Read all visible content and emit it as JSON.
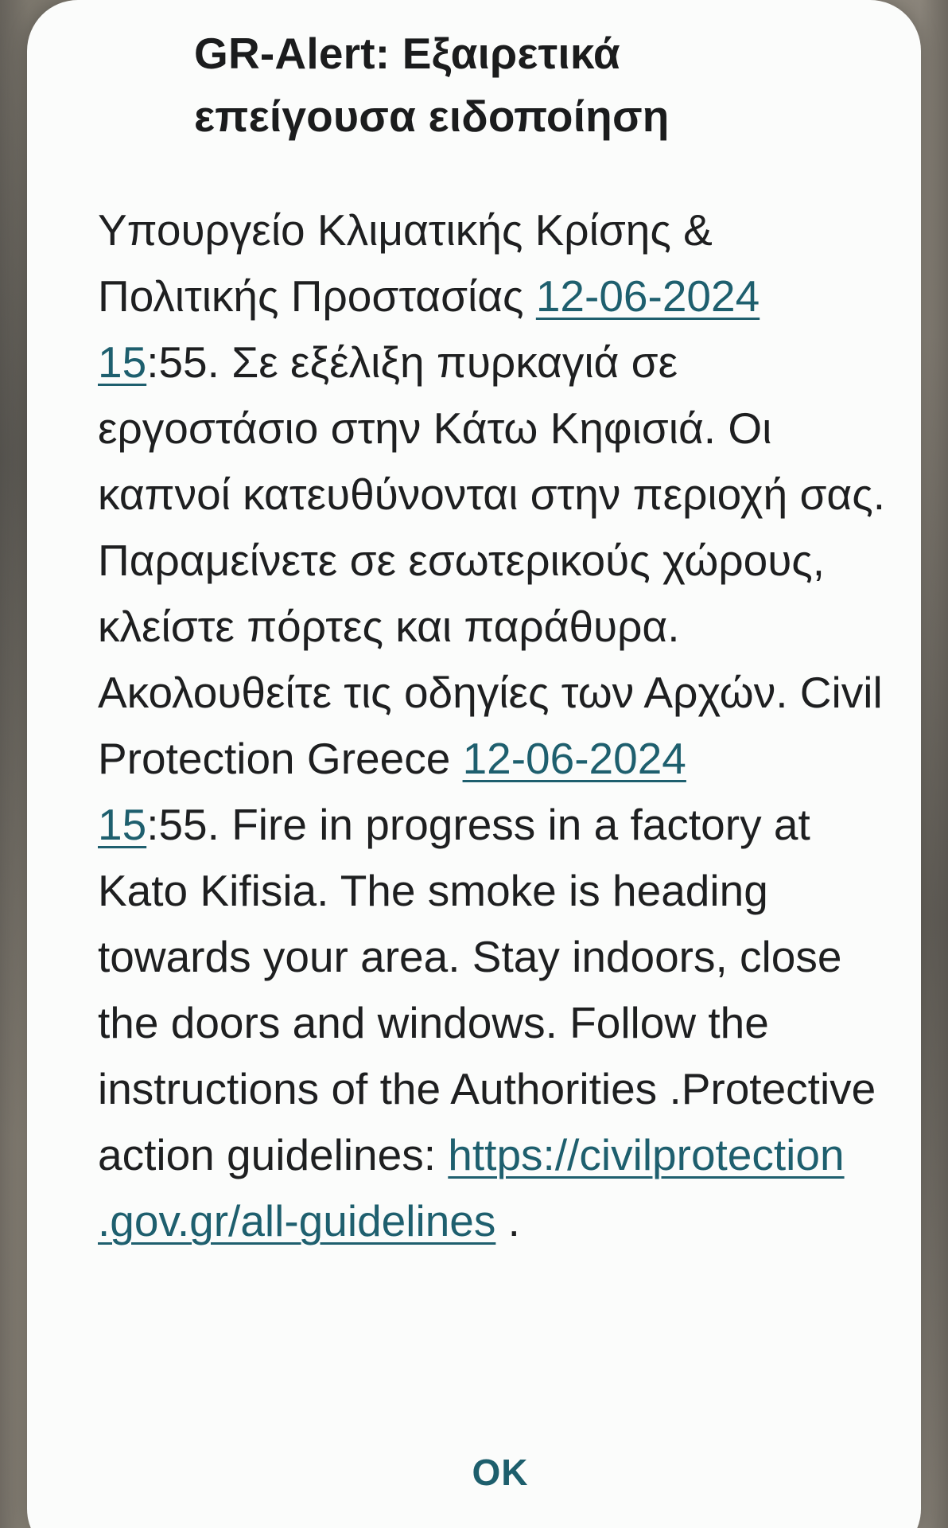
{
  "alert": {
    "title": "GR-Alert: Εξαιρετικά επείγουσα ειδοποίηση",
    "body_greek_1": "Υπουργείο Κλιματικής Κρίσης & Πολιτικής Προστασίας ",
    "greek_date": "12-06-2024",
    "greek_time_hour": "15",
    "body_greek_2": ":55. Σε εξέλιξη πυρκαγιά σε εργοστάσιο στην Κάτω Κηφισιά. Οι καπνοί κατευθύνονται στην περιοχή σας. Παραμείνετε σε εσωτερικούς χώρους, κλείστε πόρτες και παράθυρα. Ακολουθείτε τις οδηγίες των Αρχών. Civil Protection Greece ",
    "english_date": "12-06-2024",
    "english_time_hour": "15",
    "body_english": ":55. Fire in progress in a  factory at Kato Kifisia. The smoke is heading towards your area. Stay indoors, close the doors and windows. Follow the instructions of the Authorities .Protective action guidelines: ",
    "guidelines_link": "https://civilprotection.gov.gr/all-guidelines",
    "trailing": " ."
  },
  "actions": {
    "ok_label": "OK"
  },
  "colors": {
    "accent": "#1d5e6c",
    "dialog_background": "#fbfcfb",
    "text": "#1e1f20"
  }
}
